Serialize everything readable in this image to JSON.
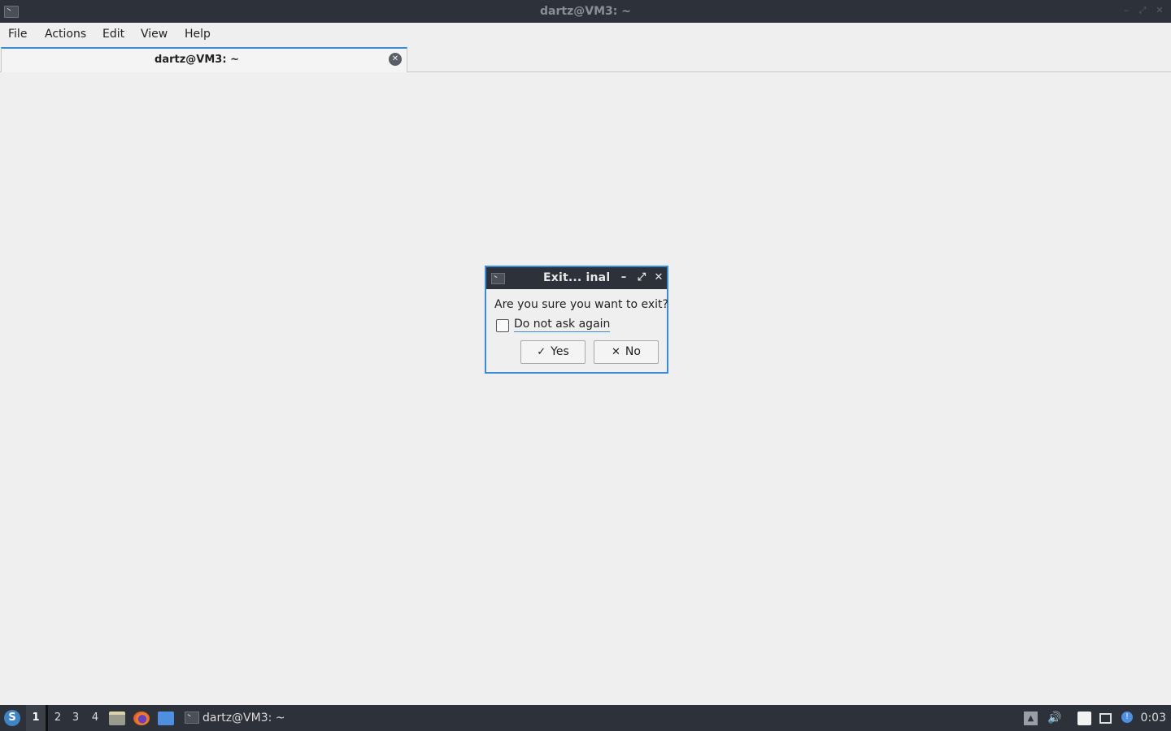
{
  "window": {
    "title": "dartz@VM3: ~",
    "controls": {
      "minimize": "–",
      "maximize": "⤢",
      "close": "✕"
    }
  },
  "menubar": {
    "items": [
      "File",
      "Actions",
      "Edit",
      "View",
      "Help"
    ]
  },
  "tabs": [
    {
      "label": "dartz@VM3: ~",
      "active": true
    }
  ],
  "dialog": {
    "title": "Exit...  inal",
    "controls": {
      "minimize": "–",
      "maximize": "⤢",
      "close": "✕"
    },
    "message": "Are you sure you want to exit?",
    "checkbox": {
      "label": "Do not ask again",
      "checked": false
    },
    "yes_button": {
      "icon": "✓",
      "label": "Yes"
    },
    "no_button": {
      "icon": "✕",
      "label": "No"
    }
  },
  "taskbar": {
    "workspaces": [
      "1",
      "2",
      "3",
      "4"
    ],
    "active_workspace": "1",
    "launchers": [
      "file-manager-icon",
      "firefox-icon",
      "desktop-icon"
    ],
    "task": {
      "label": "dartz@VM3: ~"
    },
    "tray": [
      "battery-icon",
      "volume-icon",
      "clipboard-icon",
      "network-icon",
      "update-icon"
    ],
    "clock": "0:03"
  },
  "colors": {
    "accent": "#3c8bd9",
    "titlebar": "#2d3139",
    "background": "#efefef"
  }
}
